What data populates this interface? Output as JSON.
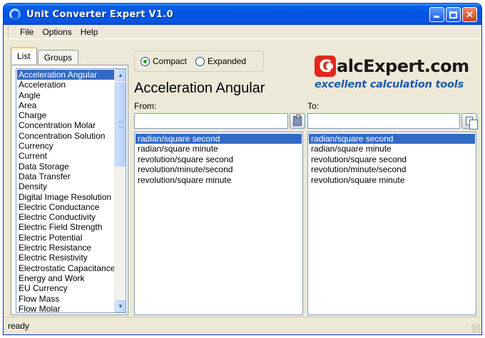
{
  "window": {
    "title": "Unit Converter Expert V1.0"
  },
  "menu": {
    "items": [
      "File",
      "Options",
      "Help"
    ]
  },
  "tabs": {
    "list": "List",
    "groups": "Groups"
  },
  "categories": [
    "Acceleration Angular",
    "Acceleration",
    "Angle",
    "Area",
    "Charge",
    "Concentration Molar",
    "Concentration Solution",
    "Currency",
    "Current",
    "Data Storage",
    "Data Transfer",
    "Density",
    "Digital Image Resolution",
    "Electric Conductance",
    "Electric Conductivity",
    "Electric Field Strength",
    "Electric Potential",
    "Electric Resistance",
    "Electric Resistivity",
    "Electrostatic Capacitance",
    "Energy and Work",
    "EU Currency",
    "Flow Mass",
    "Flow Molar"
  ],
  "view_mode": {
    "compact": "Compact",
    "expanded": "Expanded",
    "selected": "Compact"
  },
  "logo": {
    "c_letter": "C",
    "text": "alcExpert.com",
    "tagline": "excellent calculation tools"
  },
  "current_category": "Acceleration Angular",
  "from": {
    "label": "From:",
    "value": ""
  },
  "to": {
    "label": "To:",
    "value": ""
  },
  "units": [
    "radian/square second",
    "radian/square minute",
    "revolution/square second",
    "revolution/minute/second",
    "revolution/square minute"
  ],
  "status": {
    "text": "ready"
  },
  "colors": {
    "selection": "#316ac5",
    "titlebar": "#0054e3",
    "logo_red": "#e3261d",
    "logo_blue": "#1f5aa8"
  }
}
